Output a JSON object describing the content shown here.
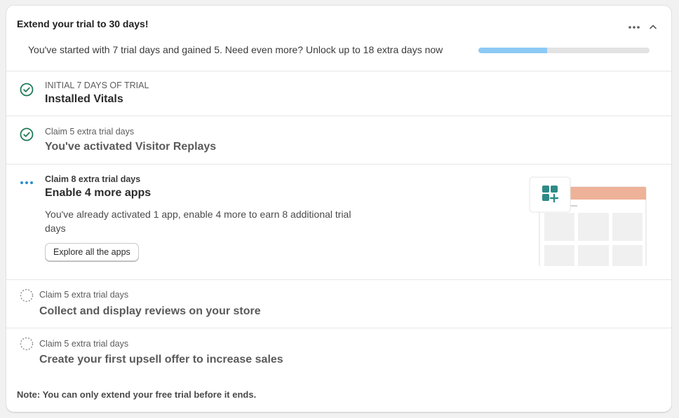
{
  "header": {
    "title": "Extend your trial to 30 days!",
    "progress_text": "You've started with 7 trial days and gained 5. Need even more? Unlock up to 18 extra days now",
    "progress_fraction": 0.4,
    "progress_color": "#8ccaf5"
  },
  "steps": [
    {
      "status": "completed",
      "icon": "check-circle-icon",
      "subtitle": "INITIAL 7 DAYS OF TRIAL",
      "title": "Installed Vitals"
    },
    {
      "status": "completed",
      "icon": "check-circle-icon",
      "subtitle": "Claim 5 extra trial days",
      "title": "You've activated Visitor Replays"
    },
    {
      "status": "in-progress",
      "icon": "dots-icon",
      "subtitle": "Claim 8 extra trial days",
      "title": "Enable 4 more apps",
      "description": "You've already activated 1 app, enable 4 more to earn 8 additional trial days",
      "button_label": "Explore all the apps"
    },
    {
      "status": "pending",
      "icon": "dashed-circle-icon",
      "subtitle": "Claim 5 extra trial days",
      "title": "Collect and display reviews on your store"
    },
    {
      "status": "pending",
      "icon": "dashed-circle-icon",
      "subtitle": "Claim 5 extra trial days",
      "title": "Create your first upsell offer to increase sales"
    }
  ],
  "note": "Note: You can only extend your free trial before it ends.",
  "colors": {
    "success": "#1e7b58",
    "in_progress": "#2a8fcf",
    "pending": "#8a8a8a",
    "illustration_header": "#eeb298",
    "illustration_icon": "#2e8a86"
  }
}
